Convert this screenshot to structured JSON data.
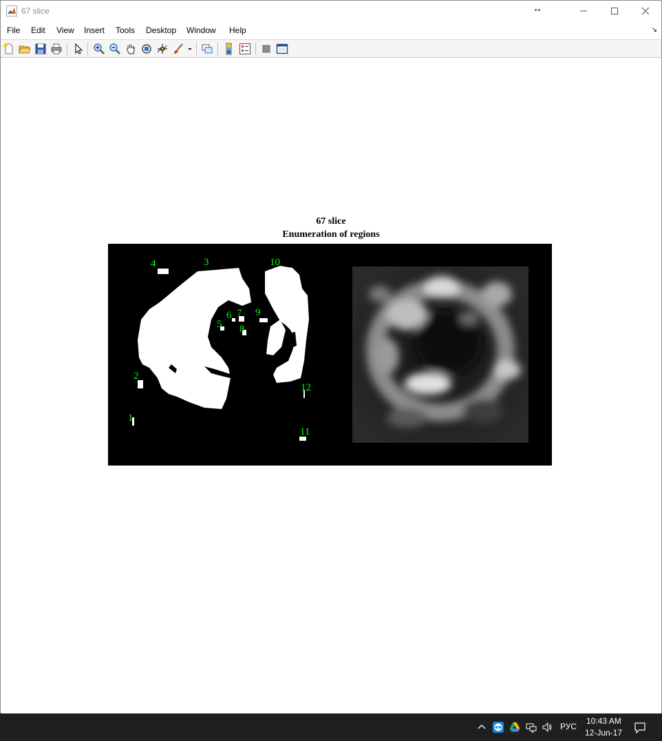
{
  "window": {
    "title": "67 slice",
    "controls": {
      "minimize": "—",
      "maximize": "☐",
      "close": "✕"
    },
    "resize_glyph": "↔"
  },
  "menu": {
    "items": [
      "File",
      "Edit",
      "View",
      "Insert",
      "Tools",
      "Desktop",
      "Window",
      "Help"
    ],
    "overflow_arrow": "↘"
  },
  "toolbar": {
    "buttons": [
      "new-figure-icon",
      "open-file-icon",
      "save-icon",
      "print-icon",
      "pointer-icon",
      "zoom-in-icon",
      "zoom-out-icon",
      "pan-icon",
      "rotate-3d-icon",
      "data-cursor-icon",
      "brush-icon",
      "link-plot-icon",
      "colorbar-icon",
      "legend-icon",
      "hide-plot-tools-icon",
      "show-plot-tools-icon"
    ]
  },
  "plot": {
    "title_line1": "67 slice",
    "title_line2": "Enumeration of regions",
    "region_labels": [
      "1",
      "2",
      "3",
      "4",
      "5",
      "6",
      "7",
      "8",
      "9",
      "10",
      "11",
      "12"
    ],
    "label_color": "#00ff00"
  },
  "taskbar": {
    "language": "РУС",
    "time": "10:43 AM",
    "date": "12-Jun-17",
    "tray_icons": [
      "chevron-up-icon",
      "teamviewer-icon",
      "google-drive-icon",
      "network-icon",
      "volume-icon"
    ]
  }
}
